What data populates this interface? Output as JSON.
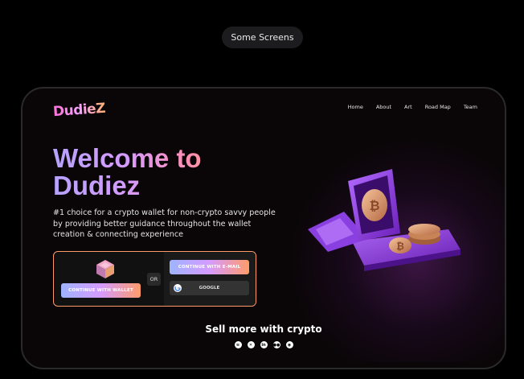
{
  "pill": {
    "label": "Some Screens"
  },
  "header": {
    "logo": "DudieZ",
    "nav": [
      "Home",
      "About",
      "Art",
      "Road Map",
      "Team"
    ]
  },
  "hero": {
    "title_line1": "Welcome to",
    "title_line2": "Dudiez",
    "description": "#1 choice for a crypto wallet for non-crypto savvy people by providing better guidance throughout the wallet creation & connecting experience"
  },
  "auth": {
    "wallet_button": "CONTINUE WITH WALLET",
    "or_label": "OR",
    "email_button": "CONTINUE WITH E-MAIL",
    "google_button": "GOOGLE"
  },
  "footer": {
    "tagline": "Sell more with crypto",
    "socials": [
      "spotify-icon",
      "x-icon",
      "linkedin-icon",
      "medium-icon",
      "discord-icon"
    ]
  },
  "colors": {
    "accent_start": "#9eb4ff",
    "accent_mid": "#d59bff",
    "accent_end": "#ff9b6a",
    "background": "#0a0607"
  }
}
